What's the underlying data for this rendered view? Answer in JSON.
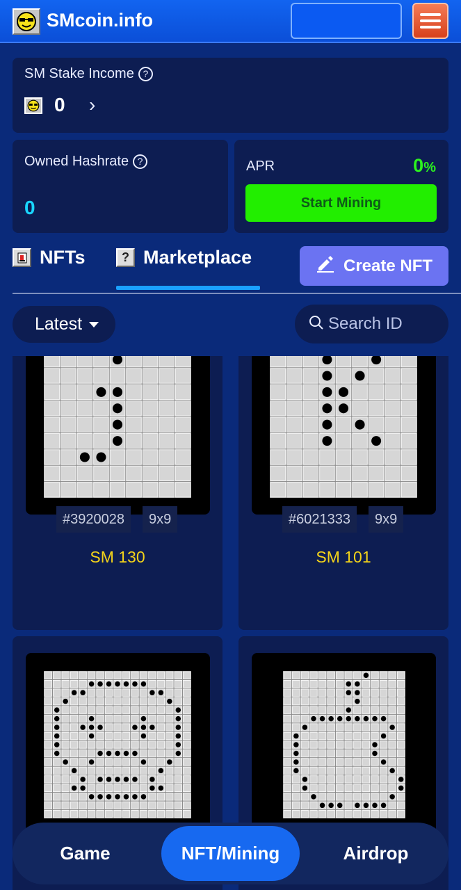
{
  "header": {
    "brand": "SMcoin.info",
    "logo_icon": "sunglasses-smiley-icon",
    "menu_icon": "hamburger-icon"
  },
  "stake": {
    "title": "SM Stake Income",
    "value": "0"
  },
  "hashrate": {
    "title": "Owned Hashrate",
    "value": "0"
  },
  "apr": {
    "title": "APR",
    "value": "0",
    "unit": "%",
    "button": "Start Mining"
  },
  "tabs": {
    "nfts": "NFTs",
    "marketplace": "Marketplace",
    "active": "marketplace",
    "create_button": "Create NFT"
  },
  "filter": {
    "sort": "Latest",
    "search_placeholder": "Search ID"
  },
  "nfts": [
    {
      "id": "#3920028",
      "size": "9x9",
      "name": "SM 130"
    },
    {
      "id": "#6021333",
      "size": "9x9",
      "name": "SM 101"
    },
    {
      "id": "",
      "size": "",
      "name": ""
    },
    {
      "id": "",
      "size": "",
      "name": ""
    }
  ],
  "bottom_nav": {
    "items": [
      "Game",
      "NFT/Mining",
      "Airdrop"
    ],
    "active": "NFT/Mining"
  },
  "colors": {
    "header": "#1264f0",
    "card": "#0d1d52",
    "accent_cyan": "#19d5ff",
    "accent_green": "#22ee00",
    "gold": "#f3d31a",
    "create_button": "#6b73f2"
  }
}
